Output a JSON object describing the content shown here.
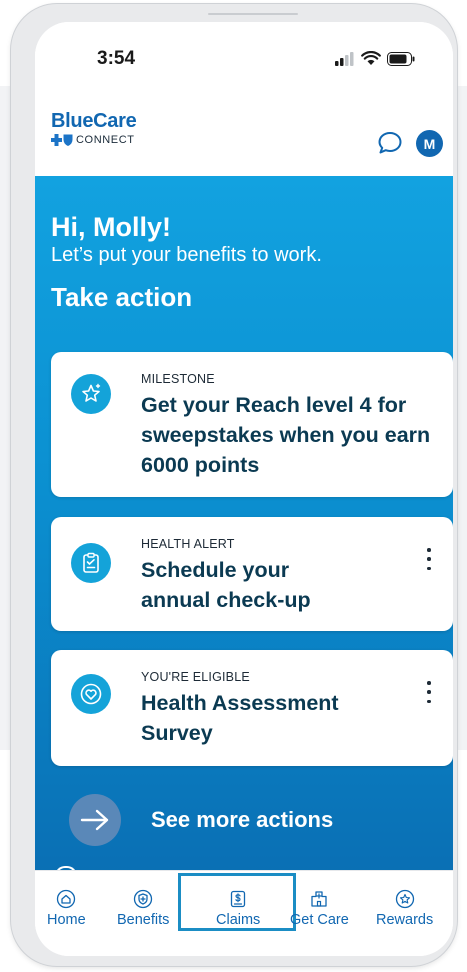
{
  "status_bar": {
    "time": "3:54"
  },
  "header": {
    "brand_name": "BlueCare",
    "brand_sub": "CONNECT",
    "avatar_initial": "M",
    "icons": {
      "chat": "chat-bubble-icon",
      "logo": "cross-shield-logo-icon"
    }
  },
  "hero": {
    "greeting": "Hi, Molly!",
    "subtitle": "Let’s put your benefits to work.",
    "section_title": "Take action",
    "cards": [
      {
        "kicker": "MILESTONE",
        "title": "Get your Reach level 4 for sweepstakes when you earn 6000 points",
        "icon": "star-icon"
      },
      {
        "kicker": "HEALTH ALERT",
        "title": "Schedule your annual check-up",
        "icon": "clipboard-check-icon"
      },
      {
        "kicker": "YOU'RE ELIGIBLE",
        "title": "Health Assessment Survey",
        "icon": "heart-icon"
      }
    ],
    "see_more_label": "See more actions"
  },
  "nav": {
    "items": [
      {
        "label": "Home",
        "icon": "home-icon"
      },
      {
        "label": "Benefits",
        "icon": "shield-plus-icon"
      },
      {
        "label": "Claims",
        "icon": "dollar-doc-icon",
        "highlighted": true
      },
      {
        "label": "Get Care",
        "icon": "hospital-icon"
      },
      {
        "label": "Rewards",
        "icon": "star-badge-icon"
      }
    ]
  },
  "colors": {
    "brand_blue": "#1167b1",
    "hero_top": "#12a2e0",
    "hero_bottom": "#0a6fb4",
    "card_icon": "#14a3d9",
    "card_title": "#0b3a52",
    "highlight_border": "#1b8dc4"
  }
}
